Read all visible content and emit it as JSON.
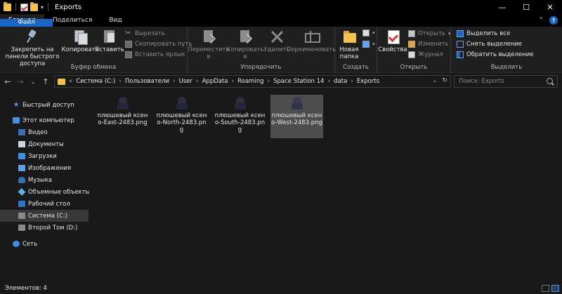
{
  "window": {
    "title": "Exports",
    "controls": {
      "minimize": "—",
      "maximize": "☐",
      "close": "✕"
    }
  },
  "tabs": [
    {
      "label": "Файл"
    },
    {
      "label": "Главная"
    },
    {
      "label": "Поделиться"
    },
    {
      "label": "Вид"
    }
  ],
  "ribbon": {
    "clipboard": {
      "label": "Буфер обмена",
      "pin": "Закрепить на панели быстрого доступа",
      "copy": "Копировать",
      "paste": "Вставить",
      "cut": "Вырезать",
      "copy_path": "Скопировать путь",
      "paste_shortcut": "Вставить ярлык"
    },
    "organize": {
      "label": "Упорядочить",
      "move_to": "Переместить в",
      "copy_to": "Копировать в",
      "delete": "Удалить",
      "rename": "Переименовать"
    },
    "create": {
      "label": "Создать",
      "new_folder": "Новая папка"
    },
    "open": {
      "label": "Открыть",
      "properties": "Свойства",
      "open": "Открыть",
      "edit": "Изменить",
      "history": "Журнал"
    },
    "select": {
      "label": "Выделить",
      "select_all": "Выделить все",
      "select_none": "Снять выделение",
      "invert": "Обратить выделение"
    }
  },
  "address": {
    "overflow": "«",
    "crumbs": [
      "Система (C:)",
      "Пользователи",
      "User",
      "AppData",
      "Roaming",
      "Space Station 14",
      "data",
      "Exports"
    ],
    "search_placeholder": "Поиск: Exports"
  },
  "nav": {
    "quick_access": "Быстрый доступ",
    "this_pc": "Этот компьютер",
    "video": "Видео",
    "documents": "Документы",
    "downloads": "Загрузки",
    "images": "Изображения",
    "music": "Музыка",
    "objects3d": "Объемные объекты",
    "desktop": "Рабочий стол",
    "system_c": "Система (C:)",
    "second_d": "Второй Том (D:)",
    "network": "Сеть"
  },
  "files": [
    {
      "name": "плюшевый ксено-East-2483.png",
      "selected": false
    },
    {
      "name": "плюшевый ксено-North-2483.png",
      "selected": false
    },
    {
      "name": "плюшевый ксено-South-2483.png",
      "selected": false
    },
    {
      "name": "плюшевый ксено-West-2483.png",
      "selected": true
    }
  ],
  "status": {
    "items": "Элементов: 4"
  }
}
